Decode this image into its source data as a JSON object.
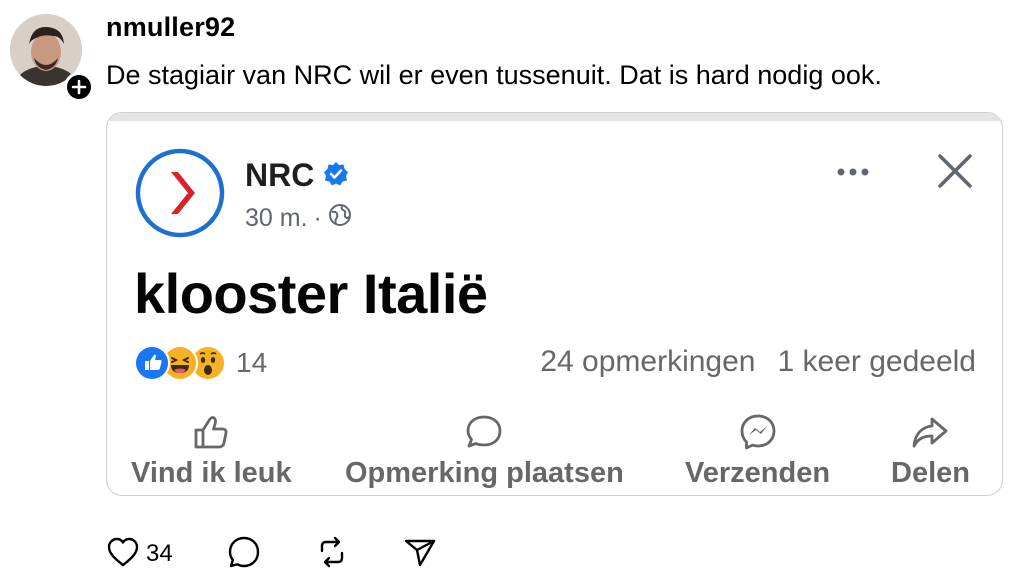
{
  "post": {
    "username": "nmuller92",
    "text": "De stagiair van NRC wil er even tussenuit. Dat is hard nodig ook.",
    "likes": "34"
  },
  "card": {
    "page_name": "NRC",
    "time": "30 m.",
    "separator": "·",
    "headline": "klooster Italië",
    "reaction_count": "14",
    "comments": "24 opmerkingen",
    "shares": "1 keer gedeeld",
    "actions": {
      "like": "Vind ik leuk",
      "comment": "Opmerking plaatsen",
      "send": "Verzenden",
      "share": "Delen"
    }
  },
  "colors": {
    "nrc_red": "#d8232a",
    "nrc_blue_ring": "#1f6fd1",
    "verified_blue": "#1877f2",
    "muted_text": "#65676b"
  },
  "icons": {
    "card": [
      "globe-icon",
      "more-icon",
      "close-icon",
      "like-reaction-icon",
      "haha-reaction-icon",
      "wow-reaction-icon",
      "thumbs-up-icon",
      "comment-icon",
      "messenger-icon",
      "share-icon"
    ],
    "thread": [
      "heart-icon",
      "reply-icon",
      "repost-icon",
      "send-icon"
    ]
  }
}
